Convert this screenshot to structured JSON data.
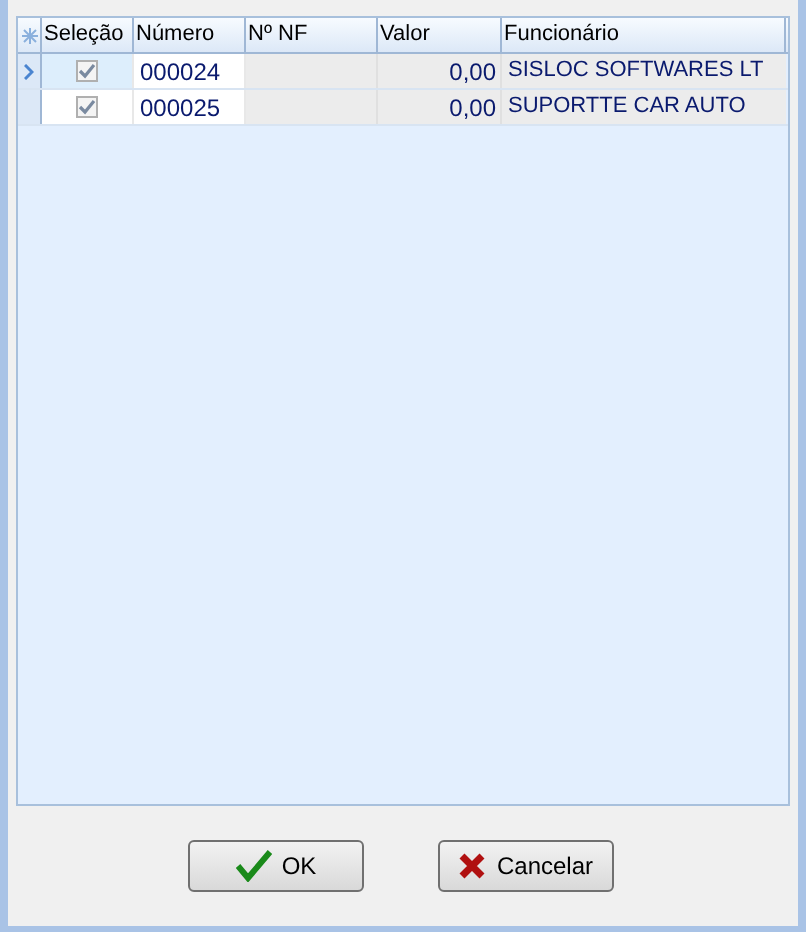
{
  "grid": {
    "columns": [
      "Seleção",
      "Número",
      "Nº NF",
      "Valor",
      "Funcionário"
    ],
    "rows": [
      {
        "current": true,
        "checked": true,
        "numero": "000024",
        "nf": "",
        "valor": "0,00",
        "funcionario": "SISLOC SOFTWARES LT"
      },
      {
        "current": false,
        "checked": true,
        "numero": "000025",
        "nf": "",
        "valor": "0,00",
        "funcionario": "SUPORTTE CAR AUTO"
      }
    ]
  },
  "buttons": [
    {
      "kind": "ok",
      "label": "OK"
    },
    {
      "kind": "cancel",
      "label": "Cancelar"
    }
  ]
}
